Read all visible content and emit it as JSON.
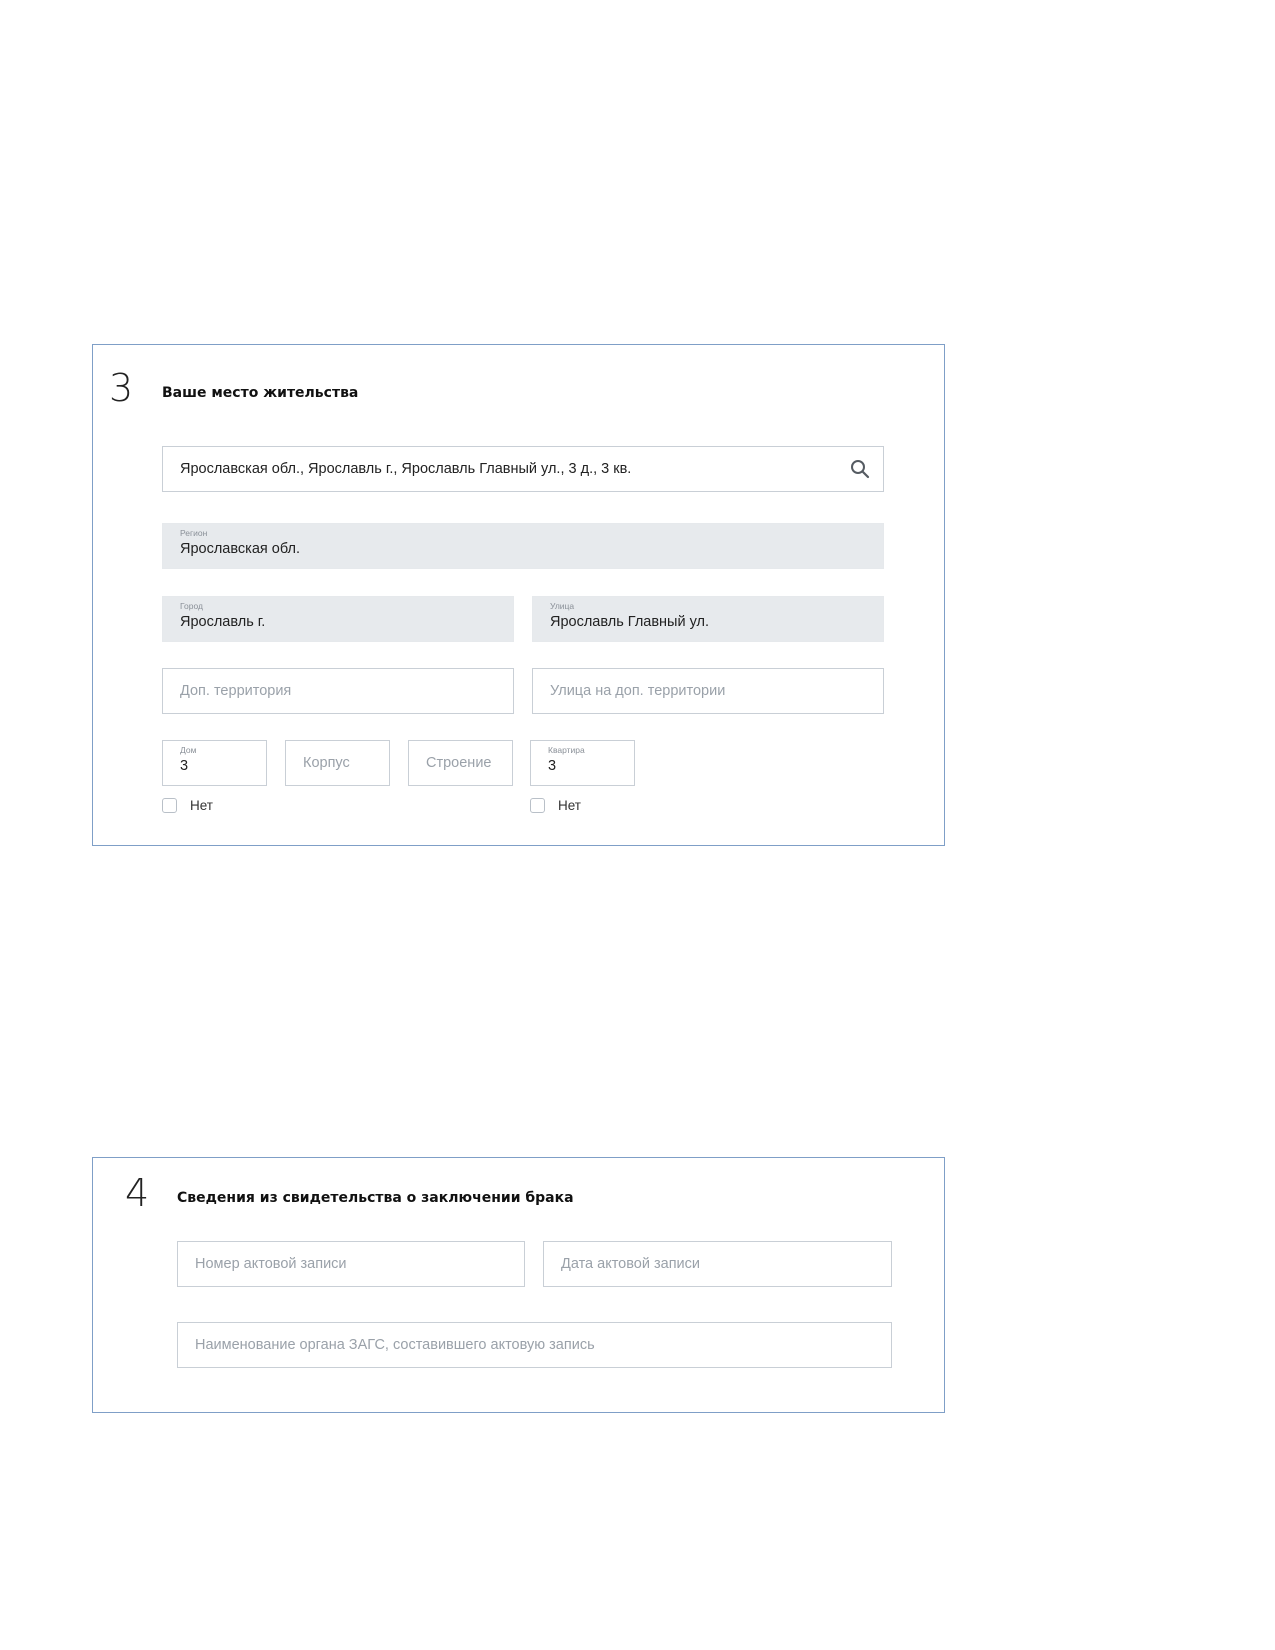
{
  "residence": {
    "step_number": "3",
    "title": "Ваше место жительства",
    "address_search": {
      "value": "Ярославская обл., Ярославль г., Ярославль Главный ул., 3 д., 3 кв."
    },
    "region": {
      "label": "Регион",
      "value": "Ярославская обл."
    },
    "city": {
      "label": "Город",
      "value": "Ярославль г."
    },
    "street": {
      "label": "Улица",
      "value": "Ярославль Главный ул."
    },
    "extra_territory": {
      "placeholder": "Доп. территория"
    },
    "extra_territory_street": {
      "placeholder": "Улица на доп. территории"
    },
    "house": {
      "label": "Дом",
      "value": "3"
    },
    "building": {
      "placeholder": "Корпус"
    },
    "structure": {
      "placeholder": "Строение"
    },
    "apartment": {
      "label": "Квартира",
      "value": "3"
    },
    "house_none_checkbox": {
      "label": "Нет",
      "checked": false
    },
    "apartment_none_checkbox": {
      "label": "Нет",
      "checked": false
    },
    "icons": {
      "search": "search-icon"
    }
  },
  "marriage_certificate": {
    "step_number": "4",
    "title": "Сведения из свидетельства о заключении брака",
    "record_number": {
      "placeholder": "Номер актовой записи"
    },
    "record_date": {
      "placeholder": "Дата актовой записи"
    },
    "registry_office_name": {
      "placeholder": "Наименование органа ЗАГС, составившего актовую запись"
    }
  },
  "colors": {
    "panel_border": "#7f9fc7",
    "readonly_fill": "#e7eaed",
    "input_border": "#c9cfd6",
    "placeholder_text": "#9aa1a9"
  }
}
